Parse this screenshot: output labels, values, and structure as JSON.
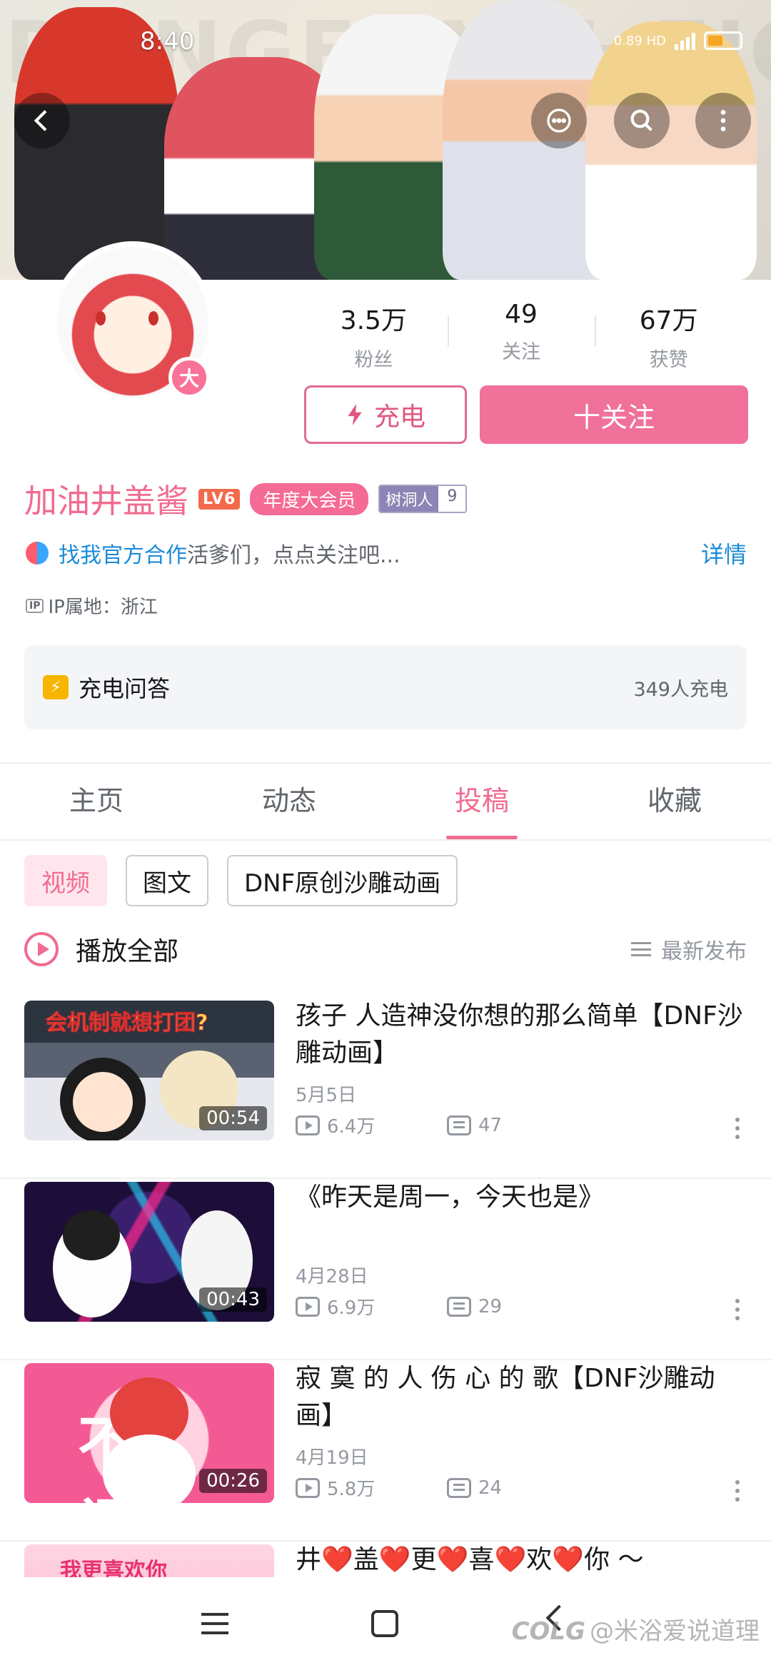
{
  "status_bar": {
    "time": "8:40",
    "right_text": "0.89 HD"
  },
  "banner": {
    "watermark": "DUNGEON & FIGHTER"
  },
  "profile": {
    "avatar_badge": "大",
    "stats": [
      {
        "value": "3.5万",
        "label": "粉丝"
      },
      {
        "value": "49",
        "label": "关注"
      },
      {
        "value": "67万",
        "label": "获赞"
      }
    ],
    "charge_button": "充电",
    "follow_button": "十关注",
    "username": "加油井盖酱",
    "level": "LV6",
    "vip_badge": "年度大会员",
    "tree_hole": {
      "label": "树洞人",
      "count": "9"
    },
    "coop_link": "找我官方合作",
    "coop_text": "活爹们，点点关注吧...",
    "coop_detail": "详情",
    "ip_icon": "IP",
    "ip_location": "IP属地：浙江"
  },
  "qa_card": {
    "title": "充电问答",
    "count": "349人充电"
  },
  "tabs": [
    {
      "label": "主页"
    },
    {
      "label": "动态"
    },
    {
      "label": "投稿"
    },
    {
      "label": "收藏"
    }
  ],
  "active_tab": "投稿",
  "chips": [
    {
      "label": "视频"
    },
    {
      "label": "图文"
    },
    {
      "label": "DNF原创沙雕动画"
    }
  ],
  "play_all": {
    "label": "播放全部",
    "sort_label": "最新发布"
  },
  "videos": [
    {
      "title": "孩子 人造神没你想的那么简单【DNF沙雕动画】",
      "date": "5月5日",
      "views": "6.4万",
      "danmaku": "47",
      "duration": "00:54",
      "thumb_caption": "会机制就想打团?"
    },
    {
      "title": "《昨天是周一，今天也是》",
      "date": "4月28日",
      "views": "6.9万",
      "danmaku": "29",
      "duration": "00:43",
      "thumb_caption": ""
    },
    {
      "title": "寂 寞 的 人 伤 心 的 歌【DNF沙雕动画】",
      "date": "4月19日",
      "views": "5.8万",
      "danmaku": "24",
      "duration": "00:26",
      "thumb_caption": "不 闪"
    },
    {
      "title": "井❤️盖❤️更❤️喜❤️欢❤️你 ～",
      "date": "",
      "views": "",
      "danmaku": "",
      "duration": "",
      "thumb_caption": "我更喜欢你"
    }
  ],
  "watermark": {
    "logo": "COLG",
    "text": "@米浴爱说道理"
  },
  "colors": {
    "accent": "#f06c90",
    "link": "#1b8bd8",
    "muted": "#9499a0"
  }
}
